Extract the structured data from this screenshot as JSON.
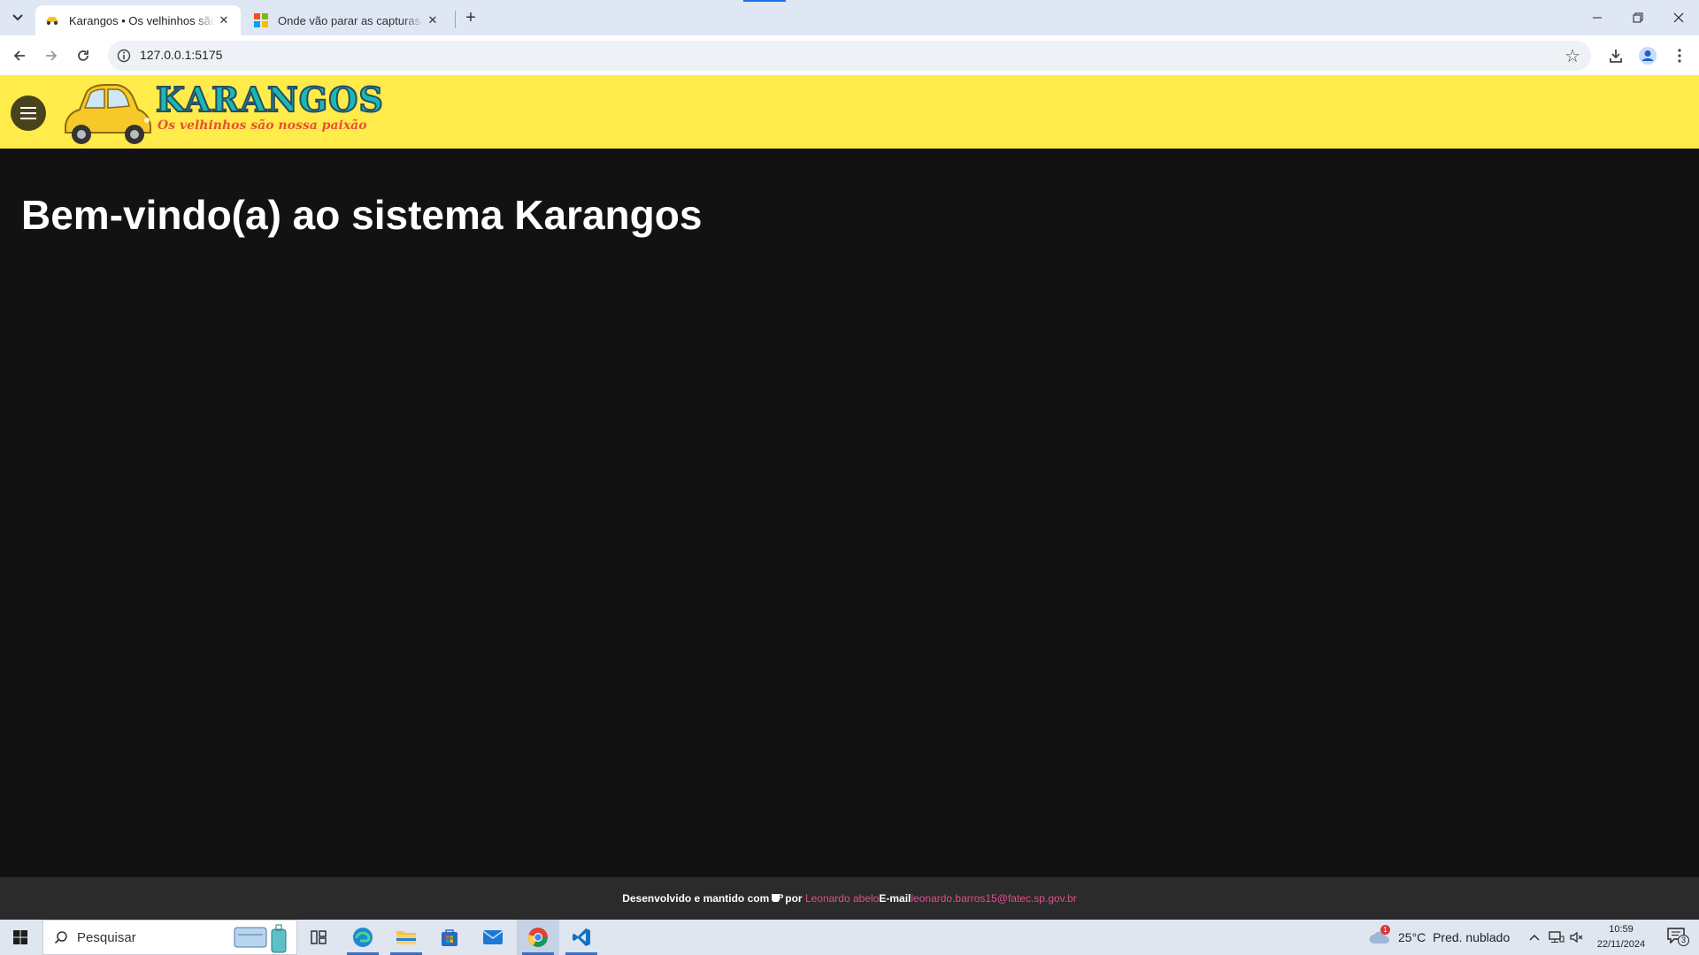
{
  "browser": {
    "tabs": [
      {
        "title": "Karangos • Os velhinhos são no",
        "active": true
      },
      {
        "title": "Onde vão parar as capturas con",
        "active": false
      }
    ],
    "url": "127.0.0.1:5175"
  },
  "header": {
    "logo_text": "KARANGOS",
    "logo_tagline": "Os velhinhos são nossa paixão"
  },
  "main": {
    "welcome": "Bem-vindo(a) ao sistema Karangos"
  },
  "footer": {
    "developed_text": "Desenvolvido e mantido com",
    "by_text": "por",
    "author": "Leonardo abelo",
    "email_label": "E-mail",
    "email": "leonardo.barros15@fatec.sp.gov.br"
  },
  "taskbar": {
    "search_placeholder": "Pesquisar",
    "weather_temp": "25°C",
    "weather_desc": "Pred. nublado",
    "weather_badge": "1",
    "time": "10:59",
    "date": "22/11/2024",
    "notification_count": "3"
  },
  "colors": {
    "header_bg": "#ffeb4a",
    "main_bg": "#121212",
    "footer_link": "#e04f8e"
  }
}
